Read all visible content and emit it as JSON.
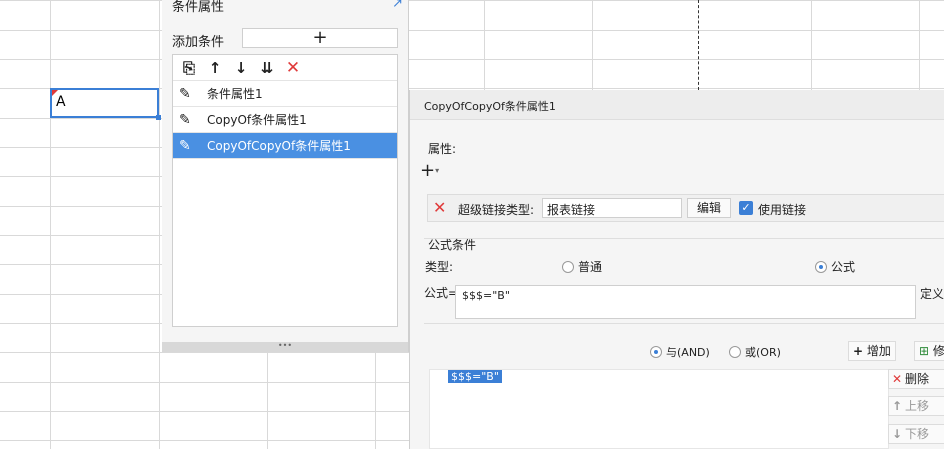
{
  "sheet": {
    "cell_value": "A"
  },
  "cond_panel": {
    "title": "条件属性",
    "add_label": "添加条件",
    "add_button": "+",
    "toolbar": {
      "copy": "⎘",
      "up": "↑",
      "down": "↓",
      "sort": "⇊",
      "delete": "✕"
    },
    "items": [
      {
        "label": "条件属性1"
      },
      {
        "label": "CopyOf条件属性1"
      },
      {
        "label": "CopyOfCopyOf条件属性1"
      }
    ],
    "resize_handle": "•••"
  },
  "dialog": {
    "title": "CopyOfCopyOf条件属性1",
    "property_label": "属性:",
    "add_property": "+",
    "hyperlink": {
      "type_label": "超级链接类型:",
      "type_value": "报表链接",
      "edit_button": "编辑",
      "use_link_label": "使用链接"
    },
    "formula_section_label": "公式条件",
    "type_label": "类型:",
    "type_options": [
      "普通",
      "公式"
    ],
    "formula_label": "公式=",
    "formula_value": "$$$=\"B\"",
    "define_button": "定义",
    "logic_options": [
      "与(AND)",
      "或(OR)"
    ],
    "add_button": "增加",
    "modify_button": "修",
    "conditions": [
      "$$$=\"B\""
    ],
    "delete_button": "删除",
    "move_up_button": "上移",
    "move_down_button": "下移"
  },
  "colors": {
    "accent": "#3b7fd6",
    "selected_row": "#4a90e2",
    "danger": "#e03a3a"
  }
}
